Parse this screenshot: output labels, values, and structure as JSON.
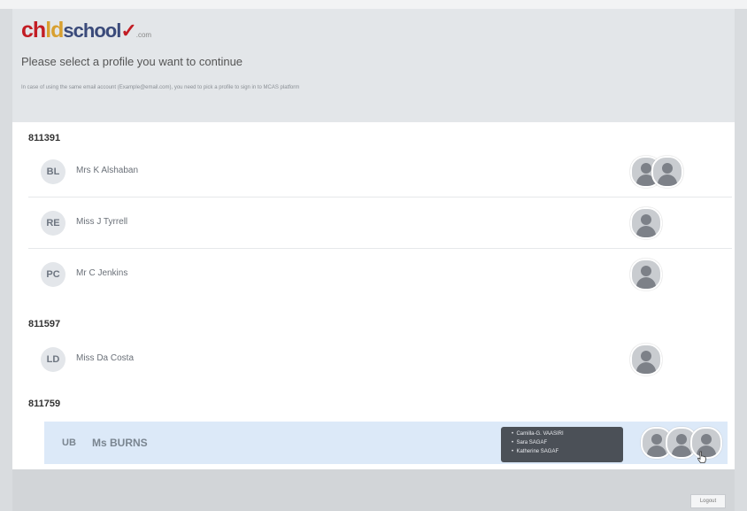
{
  "logo": {
    "part1": "ch",
    "part2": "ld",
    "part3": "school",
    "part4": ".com"
  },
  "heading": "Please select a profile you want to continue",
  "note": "In case of using the same email account (Example@email.com), you need to pick a profile to sign in to MCAS platform",
  "groups": [
    {
      "id": "811391",
      "rows": [
        {
          "initials": "BL",
          "name": "Mrs K Alshaban"
        },
        {
          "initials": "RE",
          "name": "Miss J Tyrrell"
        },
        {
          "initials": "PC",
          "name": "Mr C Jenkins"
        }
      ]
    },
    {
      "id": "811597",
      "rows": [
        {
          "initials": "LD",
          "name": "Miss Da Costa"
        }
      ]
    },
    {
      "id": "811759",
      "rows": [
        {
          "initials": "UB",
          "name": "Ms BURNS"
        }
      ]
    }
  ],
  "tooltip": {
    "items": [
      "Camilla-G. VAASIRI",
      "Sara SAGAF",
      "Katherine SAGAF"
    ]
  },
  "footer": {
    "logout_label": "Logout"
  }
}
